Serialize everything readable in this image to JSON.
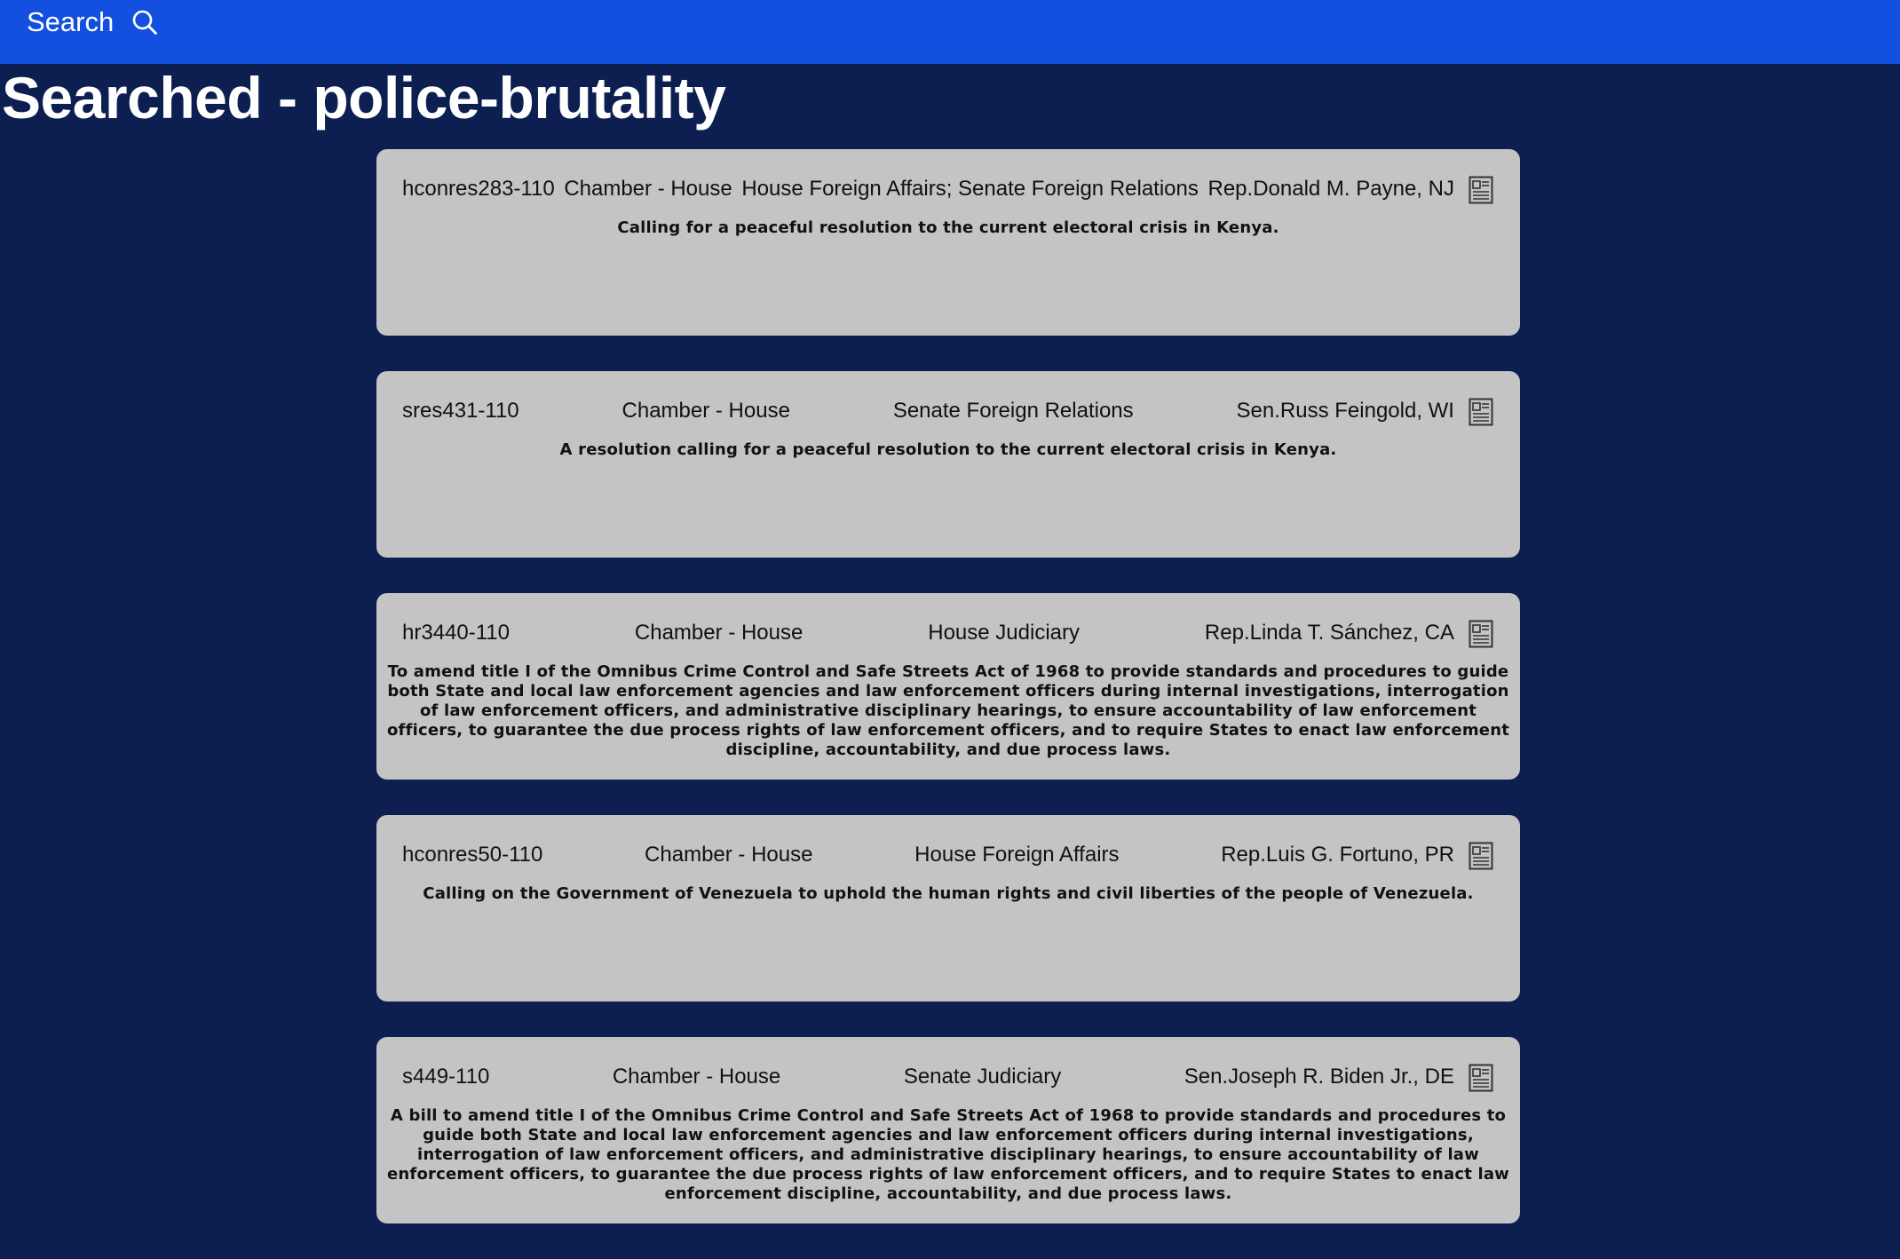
{
  "header": {
    "search_label": "Search"
  },
  "page": {
    "title": "Searched - police-brutality"
  },
  "colors": {
    "topbar": "#1450e0",
    "background": "#0d1f51",
    "card": "#c4c4c4"
  },
  "results": [
    {
      "bill_id": "hconres283-110",
      "chamber": "Chamber - House",
      "committee": "House Foreign Affairs; Senate Foreign Relations",
      "sponsor": "Rep.Donald M. Payne, NJ",
      "description": "Calling for a peaceful resolution to the current electoral crisis in Kenya.",
      "icon": "document-icon"
    },
    {
      "bill_id": "sres431-110",
      "chamber": "Chamber - House",
      "committee": "Senate Foreign Relations",
      "sponsor": "Sen.Russ Feingold, WI",
      "description": "A resolution calling for a peaceful resolution to the current electoral crisis in Kenya.",
      "icon": "document-icon"
    },
    {
      "bill_id": "hr3440-110",
      "chamber": "Chamber - House",
      "committee": "House Judiciary",
      "sponsor": "Rep.Linda T. Sánchez, CA",
      "description": "To amend title I of the Omnibus Crime Control and Safe Streets Act of 1968 to provide standards and procedures to guide both State and local law enforcement agencies and law enforcement officers during internal investigations, interrogation of law enforcement officers, and administrative disciplinary hearings, to ensure accountability of law enforcement officers, to guarantee the due process rights of law enforcement officers, and to require States to enact law enforcement discipline, accountability, and due process laws.",
      "icon": "document-icon"
    },
    {
      "bill_id": "hconres50-110",
      "chamber": "Chamber - House",
      "committee": "House Foreign Affairs",
      "sponsor": "Rep.Luis G. Fortuno, PR",
      "description": "Calling on the Government of Venezuela to uphold the human rights and civil liberties of the people of Venezuela.",
      "icon": "document-icon"
    },
    {
      "bill_id": "s449-110",
      "chamber": "Chamber - House",
      "committee": "Senate Judiciary",
      "sponsor": "Sen.Joseph R. Biden Jr., DE",
      "description": "A bill to amend title I of the Omnibus Crime Control and Safe Streets Act of 1968 to provide standards and procedures to guide both State and local law enforcement agencies and law enforcement officers during internal investigations, interrogation of law enforcement officers, and administrative disciplinary hearings, to ensure accountability of law enforcement officers, to guarantee the due process rights of law enforcement officers, and to require States to enact law enforcement discipline, accountability, and due process laws.",
      "icon": "document-icon"
    }
  ]
}
